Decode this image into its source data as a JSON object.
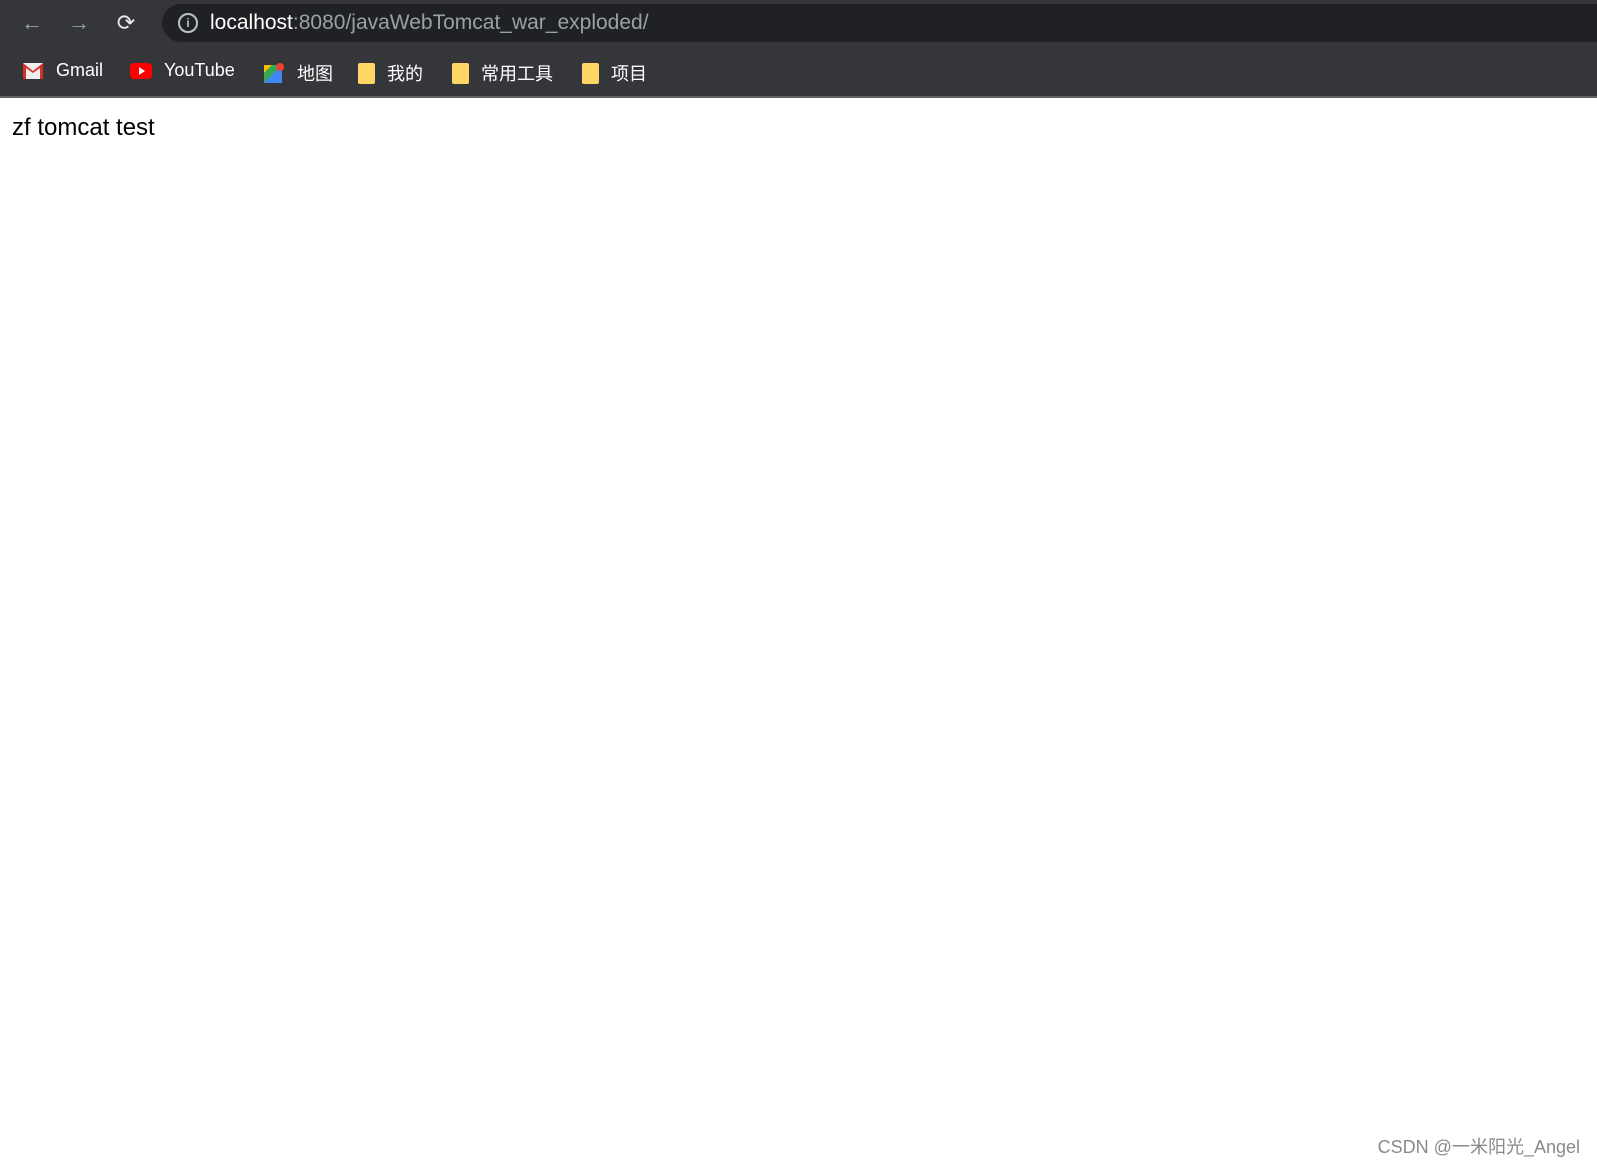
{
  "browser": {
    "url_host": "localhost",
    "url_rest": ":8080/javaWebTomcat_war_exploded/",
    "bookmarks": [
      {
        "label": "Gmail",
        "icon": "gmail-icon"
      },
      {
        "label": "YouTube",
        "icon": "youtube-icon"
      },
      {
        "label": "地图",
        "icon": "maps-icon"
      },
      {
        "label": "我的",
        "icon": "folder-icon"
      },
      {
        "label": "常用工具",
        "icon": "folder-icon"
      },
      {
        "label": "项目",
        "icon": "folder-icon"
      }
    ]
  },
  "page": {
    "text": "zf tomcat test"
  },
  "watermark": "CSDN @一米阳光_Angel"
}
